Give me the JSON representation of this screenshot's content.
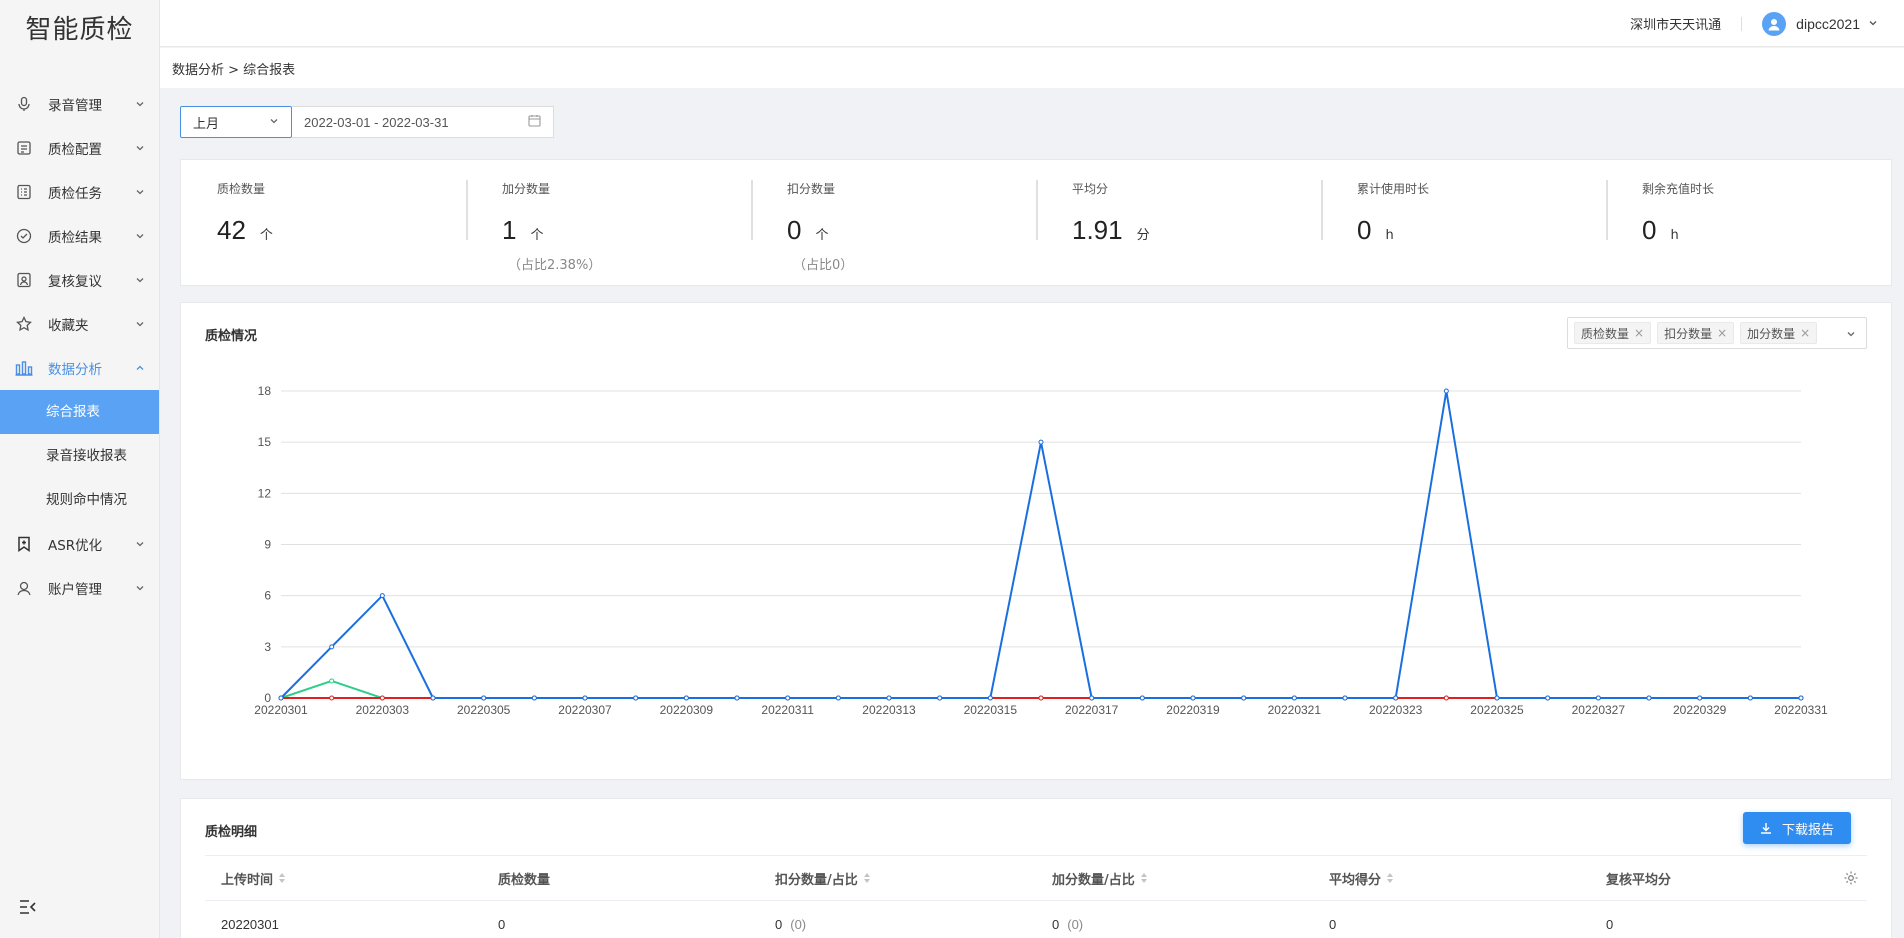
{
  "app": {
    "logo": "智能质检"
  },
  "header": {
    "company": "深圳市天天讯通",
    "username": "dipcc2021"
  },
  "sidebar": {
    "items": [
      {
        "label": "录音管理",
        "icon": "microphone-icon"
      },
      {
        "label": "质检配置",
        "icon": "document-icon"
      },
      {
        "label": "质检任务",
        "icon": "checklist-icon"
      },
      {
        "label": "质检结果",
        "icon": "check-circle-icon"
      },
      {
        "label": "复核复议",
        "icon": "badge-icon"
      },
      {
        "label": "收藏夹",
        "icon": "star-icon"
      },
      {
        "label": "数据分析",
        "icon": "bar-chart-icon",
        "expanded": true
      },
      {
        "label": "ASR优化",
        "icon": "bookmark-icon"
      },
      {
        "label": "账户管理",
        "icon": "user-icon"
      }
    ],
    "sub_items": [
      {
        "label": "综合报表",
        "active": true
      },
      {
        "label": "录音接收报表",
        "active": false
      },
      {
        "label": "规则命中情况",
        "active": false
      }
    ]
  },
  "breadcrumb": "数据分析 > 综合报表",
  "filter": {
    "period": "上月",
    "date_range": "2022-03-01 - 2022-03-31"
  },
  "stats": [
    {
      "label": "质检数量",
      "value": "42",
      "unit": "个",
      "sub": ""
    },
    {
      "label": "加分数量",
      "value": "1",
      "unit": "个",
      "sub": "（占比2.38%）"
    },
    {
      "label": "扣分数量",
      "value": "0",
      "unit": "个",
      "sub": "（占比0）"
    },
    {
      "label": "平均分",
      "value": "1.91",
      "unit": "分",
      "sub": ""
    },
    {
      "label": "累计使用时长",
      "value": "0",
      "unit": "h",
      "sub": ""
    },
    {
      "label": "剩余充值时长",
      "value": "0",
      "unit": "h",
      "sub": ""
    }
  ],
  "chart_card": {
    "title": "质检情况",
    "tags": [
      "质检数量",
      "扣分数量",
      "加分数量"
    ]
  },
  "chart_data": {
    "type": "line",
    "x": [
      "20220301",
      "20220302",
      "20220303",
      "20220304",
      "20220305",
      "20220306",
      "20220307",
      "20220308",
      "20220309",
      "20220310",
      "20220311",
      "20220312",
      "20220313",
      "20220314",
      "20220315",
      "20220316",
      "20220317",
      "20220318",
      "20220319",
      "20220320",
      "20220321",
      "20220322",
      "20220323",
      "20220324",
      "20220325",
      "20220326",
      "20220327",
      "20220328",
      "20220329",
      "20220330",
      "20220331"
    ],
    "x_tick_labels": [
      "20220301",
      "20220303",
      "20220305",
      "20220307",
      "20220309",
      "20220311",
      "20220313",
      "20220315",
      "20220317",
      "20220319",
      "20220321",
      "20220323",
      "20220325",
      "20220327",
      "20220329",
      "20220331"
    ],
    "y_ticks": [
      0,
      3,
      6,
      9,
      12,
      15,
      18
    ],
    "ylim": [
      0,
      18
    ],
    "grid": true,
    "series": [
      {
        "color": "#1a6fe0",
        "values": [
          0,
          3,
          6,
          0,
          0,
          0,
          0,
          0,
          0,
          0,
          0,
          0,
          0,
          0,
          0,
          15,
          0,
          0,
          0,
          0,
          0,
          0,
          0,
          18,
          0,
          0,
          0,
          0,
          0,
          0,
          0
        ]
      },
      {
        "color": "#e02020",
        "values": [
          0,
          0,
          0,
          0,
          0,
          0,
          0,
          0,
          0,
          0,
          0,
          0,
          0,
          0,
          0,
          0,
          0,
          0,
          0,
          0,
          0,
          0,
          0,
          0,
          0,
          0,
          0,
          0,
          0,
          0,
          0
        ]
      },
      {
        "color": "#2ecf8a",
        "values": [
          0,
          1,
          0,
          0,
          0,
          0,
          0,
          0,
          0,
          0,
          0,
          0,
          0,
          0,
          0,
          0,
          0,
          0,
          0,
          0,
          0,
          0,
          0,
          0,
          0,
          0,
          0,
          0,
          0,
          0,
          0
        ]
      }
    ]
  },
  "detail": {
    "title": "质检明细",
    "download_label": "下载报告",
    "columns": [
      "上传时间",
      "质检数量",
      "扣分数量/占比",
      "加分数量/占比",
      "平均得分",
      "复核平均分"
    ],
    "rows": [
      {
        "c0": "20220301",
        "c1": "0",
        "c2": "0",
        "c2b": "(0)",
        "c3": "0",
        "c3b": "(0)",
        "c4": "0",
        "c5": "0"
      }
    ]
  }
}
